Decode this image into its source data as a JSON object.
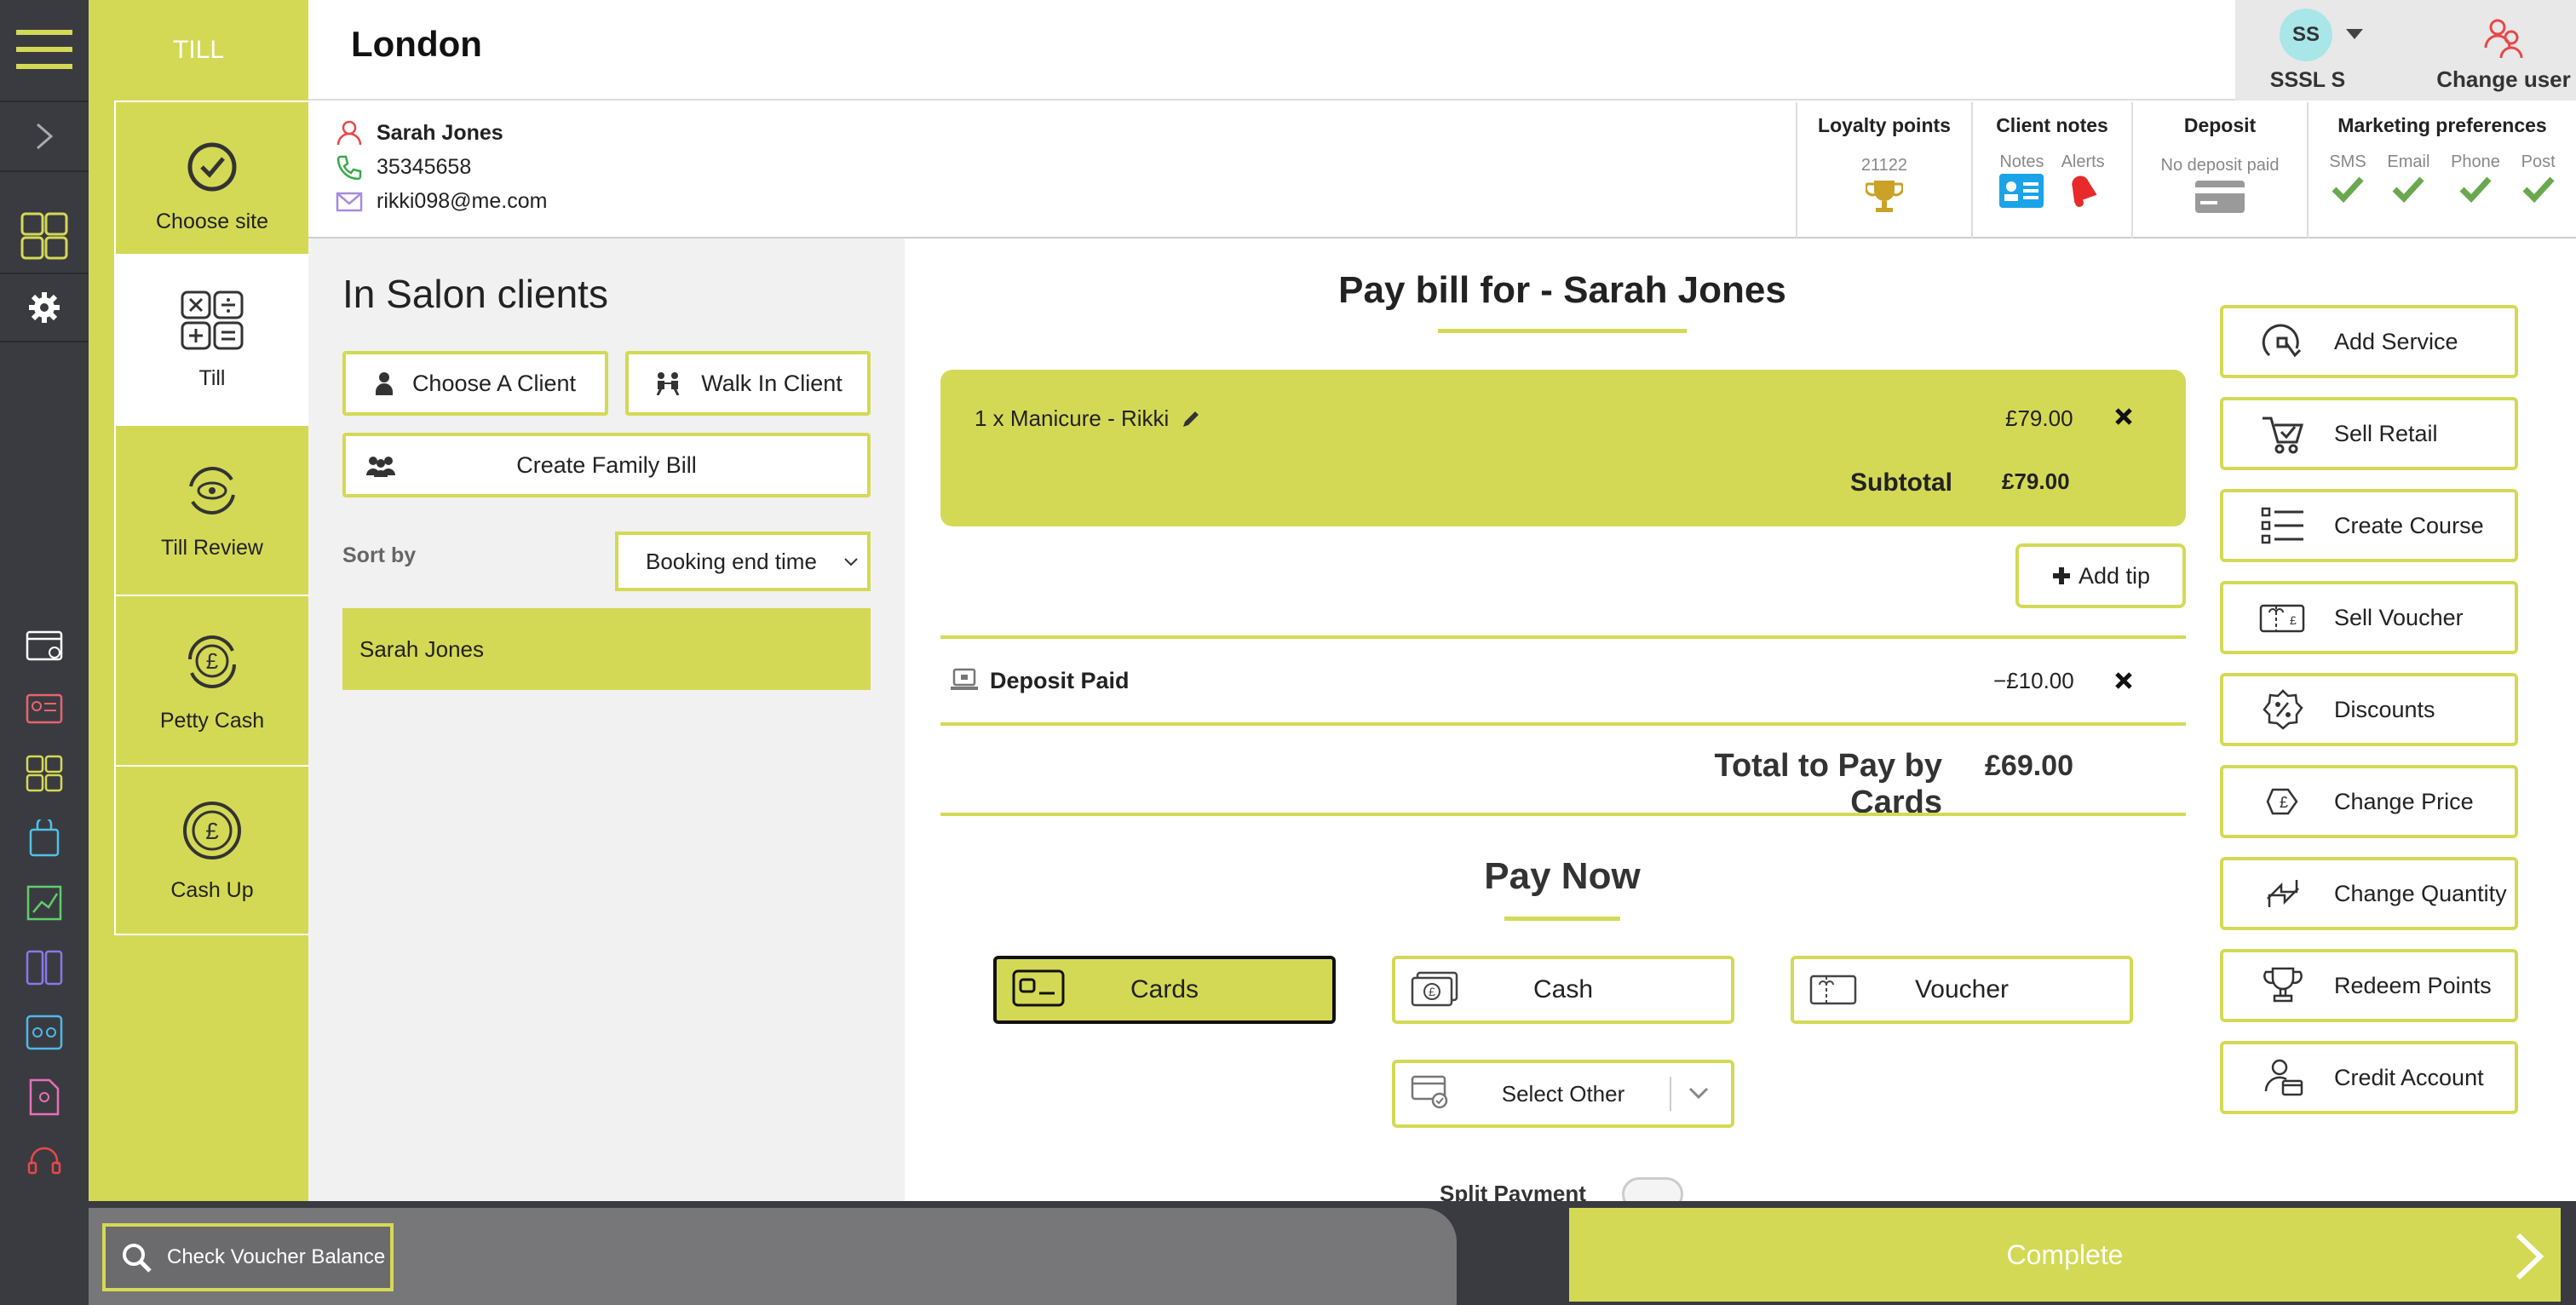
{
  "header": {
    "section": "TILL",
    "site": "London",
    "user_initials": "SS",
    "user_name": "SSSL S",
    "change_user": "Change user"
  },
  "nav": {
    "items": [
      {
        "label": "Choose site",
        "icon": "check-circle-icon"
      },
      {
        "label": "Till",
        "icon": "calculator-icon",
        "active": true
      },
      {
        "label": "Till Review",
        "icon": "eye-refresh-icon"
      },
      {
        "label": "Petty Cash",
        "icon": "pound-refresh-icon"
      },
      {
        "label": "Cash Up",
        "icon": "pound-cycle-icon"
      }
    ]
  },
  "client": {
    "name": "Sarah Jones",
    "phone": "35345658",
    "email": "rikki098@me.com",
    "loyalty": {
      "title": "Loyalty points",
      "value": "21122"
    },
    "notes": {
      "title": "Client notes",
      "notes_label": "Notes",
      "alerts_label": "Alerts"
    },
    "deposit": {
      "title": "Deposit",
      "value": "No deposit paid"
    },
    "marketing": {
      "title": "Marketing preferences",
      "channels": [
        "SMS",
        "Email",
        "Phone",
        "Post"
      ]
    }
  },
  "salon": {
    "title": "In Salon clients",
    "choose_client": "Choose A Client",
    "walk_in": "Walk In Client",
    "family_bill": "Create Family Bill",
    "sort_label": "Sort by",
    "sort_value": "Booking end time",
    "clients": [
      "Sarah Jones"
    ]
  },
  "bill": {
    "title": "Pay bill for - Sarah Jones",
    "item_label": "1 x Manicure - Rikki",
    "item_price": "£79.00",
    "subtotal_label": "Subtotal",
    "subtotal_value": "£79.00",
    "add_tip": "Add tip",
    "deposit_label": "Deposit Paid",
    "deposit_value": "−£10.00",
    "total_label": "Total to Pay by Cards",
    "total_value": "£69.00",
    "pay_now": "Pay Now",
    "methods": {
      "cards": "Cards",
      "cash": "Cash",
      "voucher": "Voucher"
    },
    "select_other": "Select Other",
    "split_payment": "Split Payment"
  },
  "actions": [
    {
      "label": "Add Service",
      "icon": "add-service-icon"
    },
    {
      "label": "Sell Retail",
      "icon": "cart-icon"
    },
    {
      "label": "Create Course",
      "icon": "list-icon"
    },
    {
      "label": "Sell Voucher",
      "icon": "voucher-icon"
    },
    {
      "label": "Discounts",
      "icon": "discount-icon"
    },
    {
      "label": "Change Price",
      "icon": "price-tag-icon"
    },
    {
      "label": "Change Quantity",
      "icon": "quantity-arrows-icon"
    },
    {
      "label": "Redeem Points",
      "icon": "trophy-icon"
    },
    {
      "label": "Credit Account",
      "icon": "credit-account-icon"
    }
  ],
  "footer": {
    "voucher_check": "Check Voucher Balance",
    "complete": "Complete"
  },
  "colors": {
    "accent": "#d4d955",
    "rail": "#3a3b40"
  }
}
